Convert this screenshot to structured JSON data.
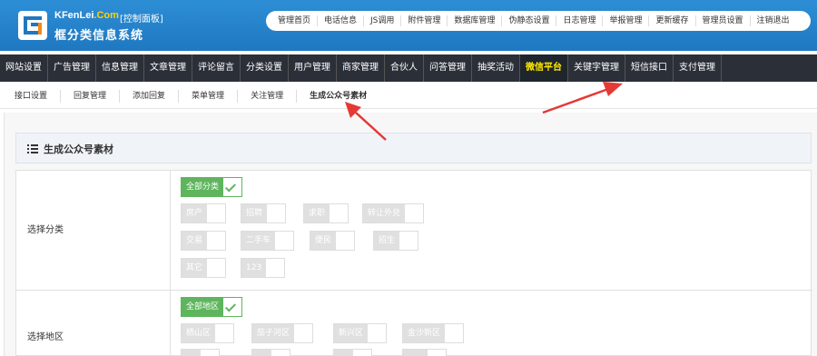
{
  "header": {
    "brand_main": "KFenLei",
    "brand_accent": ".Com",
    "panel_tag": "[控制面板]",
    "site_name": "框分类信息系统",
    "top_links": [
      "管理首页",
      "电话信息",
      "JS调用",
      "附件管理",
      "数据库管理",
      "伪静态设置",
      "日志管理",
      "举报管理",
      "更新缓存",
      "管理员设置",
      "注销退出"
    ]
  },
  "main_nav": {
    "items": [
      "网站设置",
      "广告管理",
      "信息管理",
      "文章管理",
      "评论留言",
      "分类设置",
      "用户管理",
      "商家管理",
      "合伙人",
      "问答管理",
      "抽奖活动",
      "微信平台",
      "关键字管理",
      "短信接口",
      "支付管理"
    ],
    "active_index": 11
  },
  "sub_nav": {
    "items": [
      "接口设置",
      "回复管理",
      "添加回复",
      "菜单管理",
      "关注管理",
      "生成公众号素材"
    ],
    "active_index": 5
  },
  "section": {
    "title": "生成公众号素材"
  },
  "form": {
    "category": {
      "label": "选择分类",
      "all_label": "全部分类",
      "options": [
        "房产",
        "招聘",
        "求职",
        "转让外兑",
        "交易",
        "二手车",
        "便民",
        "招生",
        "其它",
        "123"
      ]
    },
    "region": {
      "label": "选择地区",
      "all_label": "全部地区",
      "options": [
        "栖山区",
        "茄子河区",
        "新兴区",
        "金沙新区"
      ]
    }
  },
  "colors": {
    "header_blue": "#1f78c1",
    "nav_dark": "#2a2f38",
    "active_yellow": "#ffea00",
    "green": "#5eb55e",
    "arrow_red": "#e53935"
  }
}
